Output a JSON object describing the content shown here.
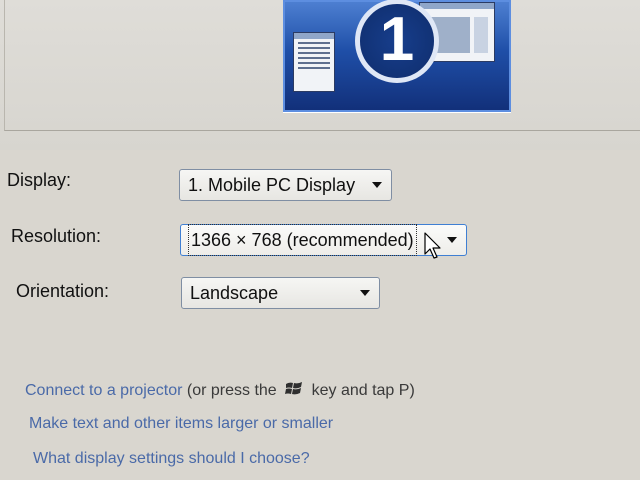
{
  "monitor": {
    "number": "1"
  },
  "display": {
    "label": "Display:",
    "value": "1. Mobile PC Display"
  },
  "resolution": {
    "label": "Resolution:",
    "value": "1366 × 768 (recommended)"
  },
  "orientation": {
    "label": "Orientation:",
    "value": "Landscape"
  },
  "links": {
    "projector_link": "Connect to a projector",
    "projector_hint_before": "(or press the",
    "projector_hint_after": "key and tap P)",
    "text_size_link": "Make text and other items larger or smaller",
    "help_link": "What display settings should I choose?"
  },
  "icons": {
    "windows_key": "windows-logo-icon",
    "dropdown_arrow": "chevron-down-icon",
    "pointer": "mouse-cursor-icon"
  },
  "colors": {
    "monitor_blue": "#1f4fa8",
    "link_blue": "#4a6aa8",
    "focus_border": "#3f7fd3",
    "background": "#d9d6cf"
  }
}
